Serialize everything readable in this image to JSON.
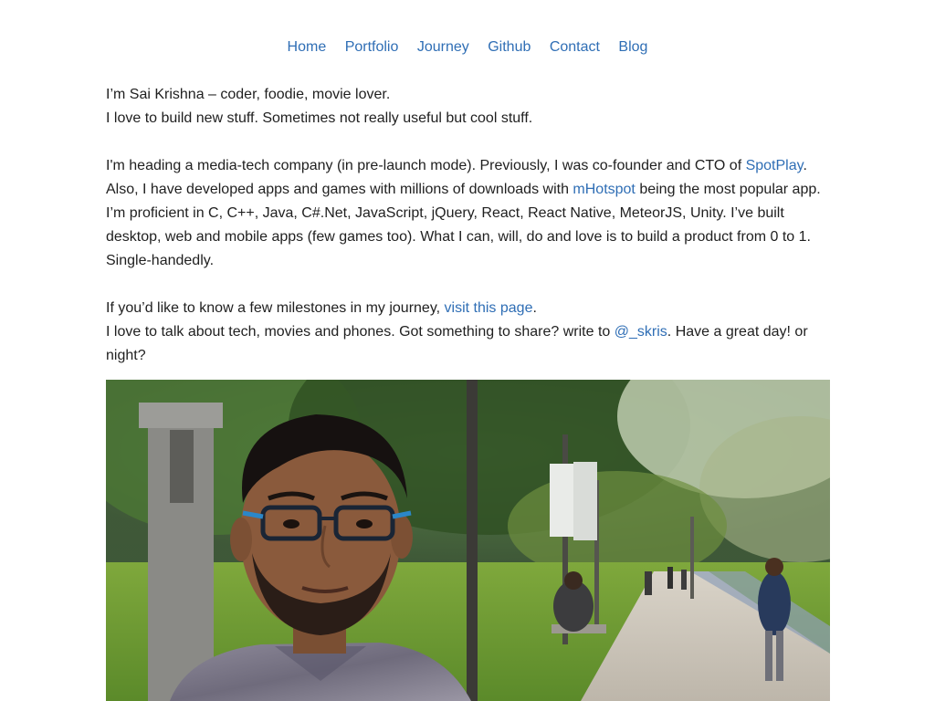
{
  "nav": {
    "items": [
      {
        "label": "Home"
      },
      {
        "label": "Portfolio"
      },
      {
        "label": "Journey"
      },
      {
        "label": "Github"
      },
      {
        "label": "Contact"
      },
      {
        "label": "Blog"
      }
    ]
  },
  "intro": {
    "line1": "I’m Sai Krishna – coder, foodie, movie lover.",
    "line2": "I love to build new stuff. Sometimes not really useful but cool stuff."
  },
  "about": {
    "part1": "I'm heading a media-tech company (in pre-launch mode). Previously, I was co-founder and CTO of ",
    "link1": "SpotPlay",
    "part2": ". Also, I have developed apps and games with millions of downloads with ",
    "link2": "mHotspot",
    "part3": " being the most popular app. I’m proficient in C, C++, Java, C#.Net, JavaScript, jQuery, React, React Native, MeteorJS, Unity. I’ve built desktop, web and mobile apps (few games too). What I can, will, do and love is to build a product from 0 to 1. Single-handedly."
  },
  "journey": {
    "part1": "If you’d like to know a few milestones in my journey, ",
    "link": "visit this page",
    "part2": ".",
    "part3": "I love to talk about tech, movies and phones. Got something to share? write to ",
    "handle": "@_skris",
    "part4": ". Have a great day! or night?"
  },
  "colors": {
    "link": "#2f6eb5",
    "text": "#1f1f1f",
    "background": "#ffffff"
  }
}
